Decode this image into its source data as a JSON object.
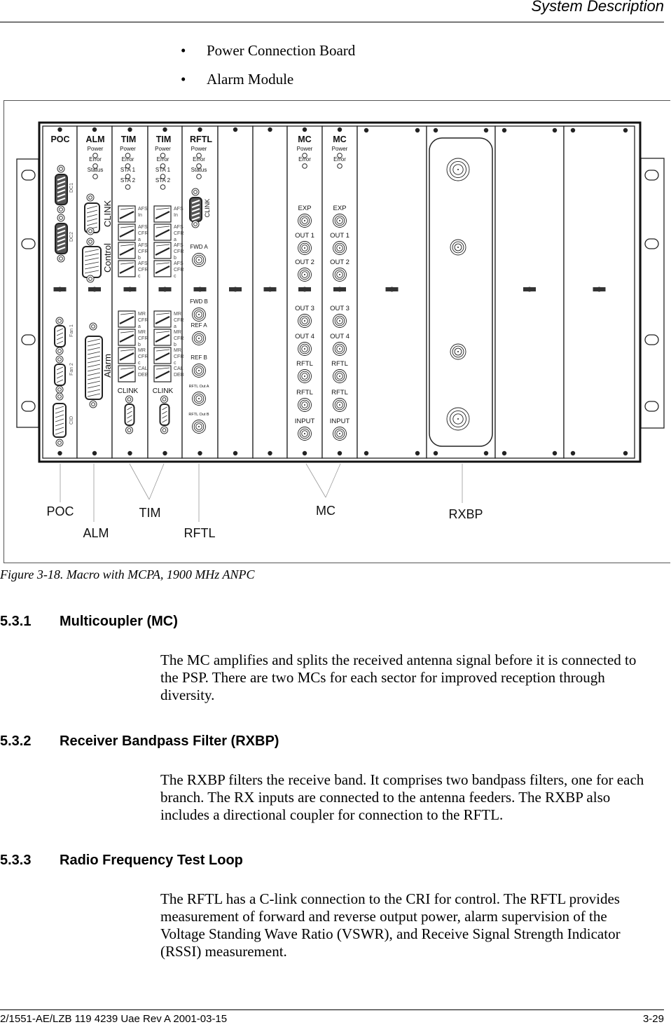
{
  "header": {
    "title": "System Description"
  },
  "bullets": [
    "Power Connection Board",
    "Alarm Module"
  ],
  "figure": {
    "caption": "Figure 3-18.  Macro with MCPA, 1900 MHz ANPC",
    "units": {
      "poc": {
        "title": "POC",
        "connectors": [
          "DC1",
          "DC2",
          "Fan 1",
          "Fan 2",
          "CID"
        ]
      },
      "alm": {
        "title": "ALM",
        "leds": [
          "Power",
          "Error",
          "Status"
        ],
        "connectors": [
          "CLINK",
          "Control",
          "Alarm"
        ]
      },
      "tim": [
        {
          "title": "TIM",
          "leds": [
            "Power",
            "Error",
            "STA 1",
            "STA 2"
          ],
          "ports_top": [
            [
              "AFS",
              "In"
            ],
            [
              "AFS",
              "CFR",
              "a"
            ],
            [
              "AFS",
              "CFR",
              "b"
            ],
            [
              "AFS",
              "CFR",
              "c"
            ]
          ],
          "ports_bottom": [
            [
              "MR",
              "CFR",
              "a"
            ],
            [
              "MR",
              "CFR",
              "b"
            ],
            [
              "MR",
              "CFR",
              "c"
            ],
            [
              "CAL",
              "DEB"
            ]
          ],
          "clink": "CLINK"
        },
        {
          "title": "TIM",
          "leds": [
            "Power",
            "Error",
            "STA 1",
            "STA 2"
          ],
          "ports_top": [
            [
              "AFS",
              "In"
            ],
            [
              "AFS",
              "CFR",
              "a"
            ],
            [
              "AFS",
              "CFR",
              "b"
            ],
            [
              "AFS",
              "CFR",
              "c"
            ]
          ],
          "ports_bottom": [
            [
              "MR",
              "CFR",
              "a"
            ],
            [
              "MR",
              "CFR",
              "b"
            ],
            [
              "MR",
              "CFR",
              "c"
            ],
            [
              "CAL",
              "DEB"
            ]
          ],
          "clink": "CLINK"
        }
      ],
      "rftl": {
        "title": "RFTL",
        "leds": [
          "Power",
          "Error",
          "Status"
        ],
        "clink": "CLINK",
        "ports": [
          "FWD A",
          "FWD B",
          "REF A",
          "REF B",
          "RFTL Out A",
          "RFTL Out B"
        ]
      },
      "mc": [
        {
          "title": "MC",
          "leds": [
            "Power",
            "Error"
          ],
          "ports": [
            "EXP",
            "OUT 1",
            "OUT 2",
            "OUT 3",
            "OUT 4",
            "RFTL",
            "RFTL",
            "INPUT"
          ]
        },
        {
          "title": "MC",
          "leds": [
            "Power",
            "Error"
          ],
          "ports": [
            "EXP",
            "OUT 1",
            "OUT 2",
            "OUT 3",
            "OUT 4",
            "RFTL",
            "RFTL",
            "INPUT"
          ]
        }
      ]
    },
    "callouts": [
      "POC",
      "ALM",
      "TIM",
      "RFTL",
      "MC",
      "RXBP"
    ]
  },
  "sections": [
    {
      "number": "5.3.1",
      "title": "Multicoupler (MC)",
      "body": "The MC amplifies and splits the received antenna signal before it is connected to the PSP. There are two MCs for each sector for improved reception through diversity."
    },
    {
      "number": "5.3.2",
      "title": "Receiver Bandpass Filter (RXBP)",
      "body": "The RXBP filters the receive band.  It comprises two bandpass filters, one for each branch.  The RX inputs are connected to the antenna feeders.  The RXBP also includes a directional coupler for connection to the RFTL."
    },
    {
      "number": "5.3.3",
      "title": "Radio Frequency Test Loop",
      "body": "The RFTL has a C-link connection to the CRI for control.  The RFTL provides measurement of forward and reverse output power, alarm supervision of the Voltage Standing Wave Ratio (VSWR), and Receive Signal Strength Indicator (RSSI) measurement."
    }
  ],
  "footer": {
    "doc_id": "2/1551-AE/LZB 119 4239 Uae Rev A 2001-03-15",
    "page": "3-29"
  }
}
